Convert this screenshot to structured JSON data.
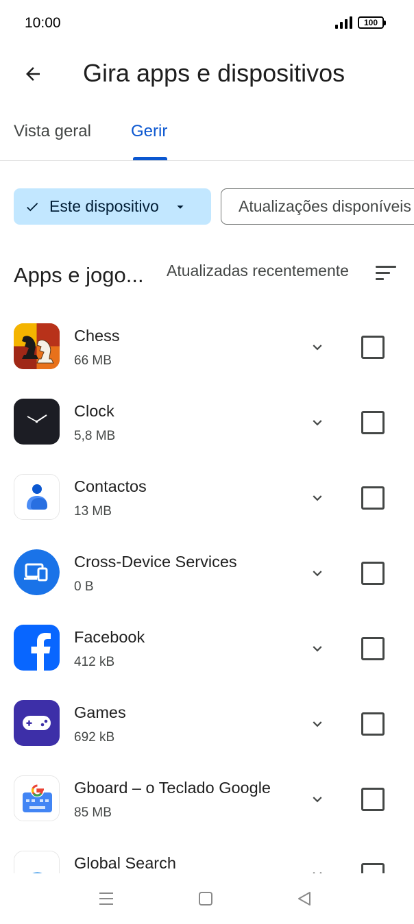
{
  "status_bar": {
    "time": "10:00",
    "battery": "100"
  },
  "header": {
    "title": "Gira apps e dispositivos"
  },
  "tabs": [
    {
      "label": "Vista geral"
    },
    {
      "label": "Gerir"
    }
  ],
  "filters": {
    "device_chip": "Este dispositivo",
    "updates_chip": "Atualizações disponíveis"
  },
  "section": {
    "title": "Apps e jogo...",
    "sort_label": "Atualizadas recentemente"
  },
  "apps": [
    {
      "name": "Chess",
      "size": "66 MB",
      "icon": "chess-icon"
    },
    {
      "name": "Clock",
      "size": "5,8 MB",
      "icon": "clock-icon"
    },
    {
      "name": "Contactos",
      "size": "13 MB",
      "icon": "contacts-icon"
    },
    {
      "name": "Cross-Device Services",
      "size": "0 B",
      "icon": "cross-device-icon"
    },
    {
      "name": "Facebook",
      "size": "412 kB",
      "icon": "facebook-icon"
    },
    {
      "name": "Games",
      "size": "692 kB",
      "icon": "games-icon"
    },
    {
      "name": "Gboard – o Teclado Google",
      "size": "85 MB",
      "icon": "gboard-icon"
    },
    {
      "name": "Global Search",
      "size": "",
      "icon": "global-search-icon"
    }
  ],
  "colors": {
    "accent": "#0b57d0",
    "chip_selected_bg": "#c2e7ff"
  }
}
